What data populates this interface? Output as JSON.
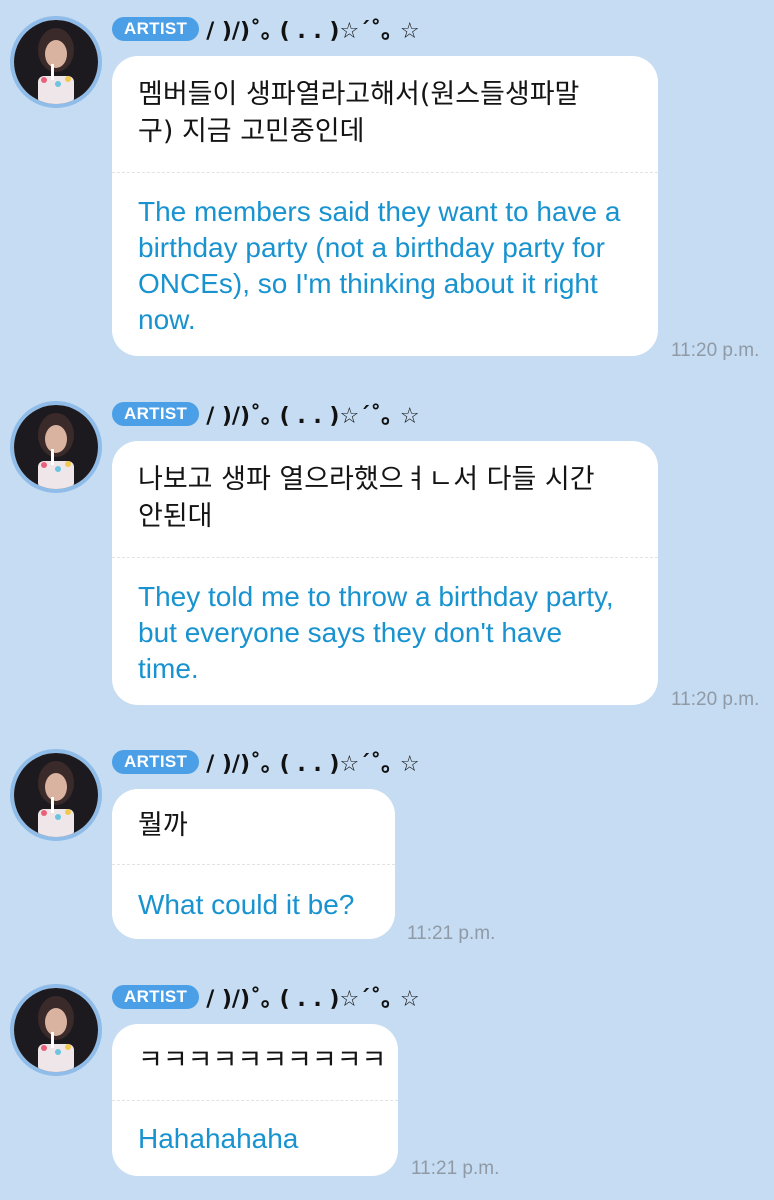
{
  "messages": [
    {
      "badge": "ARTIST",
      "nickname": "/ )/)˚｡ ( . . )☆´˚｡ ☆",
      "original": "멤버들이 생파열라고해서(원스들생파말\n구) 지금 고민중인데",
      "translation": "The members said they want to have a birthday party (not a birthday party for ONCEs), so I'm thinking about it right now.",
      "time": "11:20 p.m."
    },
    {
      "badge": "ARTIST",
      "nickname": "/ )/)˚｡ ( . . )☆´˚｡ ☆",
      "original": "나보고 생파 열으라했으ㅕㄴ서 다들 시간\n안된대",
      "translation": "They told me to throw a birthday party, but everyone says they don't have time.",
      "time": "11:20 p.m."
    },
    {
      "badge": "ARTIST",
      "nickname": "/ )/)˚｡ ( . . )☆´˚｡ ☆",
      "original": "뭘까",
      "translation": "What could it be?",
      "time": "11:21 p.m."
    },
    {
      "badge": "ARTIST",
      "nickname": "/ )/)˚｡ ( . . )☆´˚｡ ☆",
      "original": "ㅋㅋㅋㅋㅋㅋㅋㅋㅋㅋ",
      "translation": "Hahahahaha",
      "time": "11:21 p.m."
    }
  ],
  "colors": {
    "background": "#c5dcf2",
    "badge": "#4a9fe6",
    "translation_text": "#1893cf",
    "timestamp": "#8f9aa6"
  },
  "icons": {
    "avatar": "artist-profile-photo"
  }
}
